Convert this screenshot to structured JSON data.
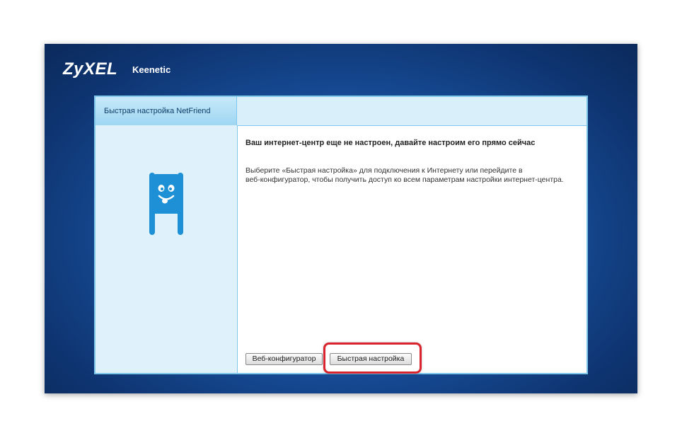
{
  "header": {
    "logo": "ZyXEL",
    "product": "Keenetic"
  },
  "sidebar": {
    "tab_label": "Быстрая настройка NetFriend",
    "mascot_icon": "netfriend-mascot-icon"
  },
  "main": {
    "heading": "Ваш интернет-центр еще не настроен, давайте настроим его прямо сейчас",
    "description_line1": "Выберите «Быстрая настройка» для подключения к Интернету или перейдите в",
    "description_line2": "веб-конфигуратор, чтобы получить доступ ко всем параметрам настройки интернет-центра.",
    "buttons": {
      "web_configurator": "Веб-конфигуратор",
      "quick_setup": "Быстрая настройка"
    }
  },
  "colors": {
    "accent": "#1e90d6",
    "highlight": "#d9232d",
    "background": "#184f9c"
  }
}
